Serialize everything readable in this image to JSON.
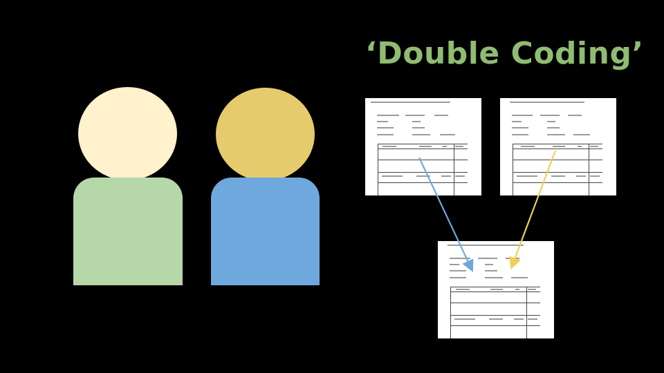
{
  "slide": {
    "title": "‘Double Coding’",
    "title_color": "#8fbc72",
    "background": "#000000"
  },
  "coders": [
    {
      "head_color": "#fff2cc",
      "body_color": "#b6d7a8"
    },
    {
      "head_color": "#e6cb6c",
      "body_color": "#6fa8dc"
    }
  ],
  "documents": [
    {
      "role": "coding-sheet-coder-1"
    },
    {
      "role": "coding-sheet-coder-2"
    },
    {
      "role": "combined-coding-sheet"
    }
  ],
  "arrows": [
    {
      "from": "coding-sheet-coder-1",
      "to": "combined-coding-sheet",
      "color": "#6fa8dc"
    },
    {
      "from": "coding-sheet-coder-2",
      "to": "combined-coding-sheet",
      "color": "#f2cf5b"
    }
  ]
}
